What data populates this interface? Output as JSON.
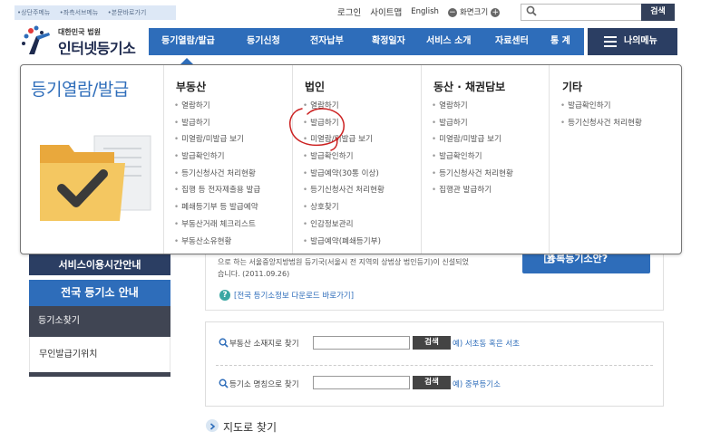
{
  "skip_links": [
    "상단주메뉴",
    "좌측서브메뉴",
    "본문바로가기"
  ],
  "utility": {
    "login": "로그인",
    "sitemap": "사이트맵",
    "english": "English",
    "zoom_label": "화면크기"
  },
  "search": {
    "placeholder": "",
    "button": "검색"
  },
  "logo": {
    "small": "대한민국 법원",
    "big": "인터넷등기소"
  },
  "gnb": [
    "등기열람/발급",
    "등기신청",
    "전자납부",
    "확정일자",
    "서비스 소개",
    "자료센터",
    "통 계"
  ],
  "mymenu": "나의메뉴",
  "mega": {
    "title": "등기열람/발급",
    "columns": [
      {
        "title": "부동산",
        "items": [
          "열람하기",
          "발급하기",
          "미열람/미발급 보기",
          "발급확인하기",
          "등기신청사건 처리현황",
          "집행 등 전자제출용 발급",
          "폐쇄등기부 등 발급예약",
          "부동산거래 체크리스트",
          "부동산소유현황"
        ]
      },
      {
        "title": "법인",
        "items": [
          "열람하기",
          "발급하기",
          "미열람/미발급 보기",
          "발급확인하기",
          "발급예약(30통 이상)",
          "등기신청사건 처리현황",
          "상호찾기",
          "인감정보관리",
          "발급예약(폐쇄등기부)"
        ]
      },
      {
        "title": "동산 · 채권담보",
        "items": [
          "열람하기",
          "발급하기",
          "미열람/미발급 보기",
          "발급확인하기",
          "등기신청사건 처리현황",
          "집행관 발급하기"
        ]
      },
      {
        "title": "기타",
        "items": [
          "발급확인하기",
          "등기신청사건 처리현황"
        ]
      }
    ]
  },
  "sidebar": {
    "service_time": "서비스이용시간안내",
    "national": "전국 등기소 안내",
    "find_registry": "등기소찾기",
    "unmanned": "무인발급기위치"
  },
  "info": {
    "line1": "으로 하는 서울중앙지방법원 등기국(서울시 전 지역의 상법상 법인등기)이 신설되었",
    "line2": "습니다. (2011.09.26)",
    "link": "[전국 등기소정보 다운로드 바로가기]",
    "sub_button": "등록등기소안?"
  },
  "find": {
    "by_address_label": "부동산 소재지로 찾기",
    "by_name_label": "등기소 명칭으로 찾기",
    "button": "검색",
    "address_example": "예) 서초동 혹은 서초",
    "name_example": "예) 중부등기소"
  },
  "map_link": "지도로 찾기",
  "colors": {
    "gnb_blue": "#2e6dba",
    "navy": "#2b3e63",
    "annotation_red": "#cc2222"
  }
}
